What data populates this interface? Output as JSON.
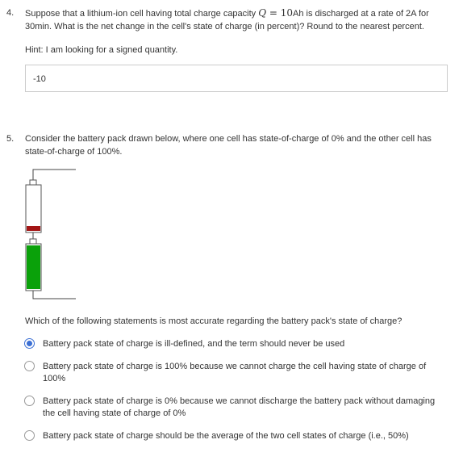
{
  "question4": {
    "number": "4.",
    "text_before_math": "Suppose that a lithium-ion cell having total charge capacity ",
    "math_var": "Q",
    "math_rest": " = 10",
    "text_after_math": "Ah is discharged at a rate of 2A for 30min. What is the net change in the cell's state of charge (in percent)? Round to the nearest percent.",
    "hint": "Hint: I am looking for a signed quantity.",
    "answer_value": "-10"
  },
  "question5": {
    "number": "5.",
    "text": "Consider the battery pack drawn below, where one cell has state-of-charge of 0% and the other cell has state-of-charge of 100%.",
    "prompt": "Which of the following statements is most accurate regarding the battery pack's state of charge?",
    "options": [
      {
        "label": "Battery pack state of charge is ill-defined, and the term should never be used",
        "selected": true
      },
      {
        "label": "Battery pack state of charge is 100% because we cannot charge the cell having state of charge of 100%",
        "selected": false
      },
      {
        "label": "Battery pack state of charge is 0% because we cannot discharge the battery pack without damaging the cell having state of charge of 0%",
        "selected": false
      },
      {
        "label": "Battery pack state of charge should be the average of the two cell states of charge (i.e., 50%)",
        "selected": false
      }
    ],
    "figure": {
      "top_cell_fill_color": "#a31515",
      "bottom_cell_fill_color": "#0aa10a",
      "top_cell_state_of_charge_percent": 0,
      "bottom_cell_state_of_charge_percent": 100
    }
  },
  "colors": {
    "text": "#333333",
    "radio_selected": "#3b6fd4",
    "input_border": "#cccccc"
  }
}
